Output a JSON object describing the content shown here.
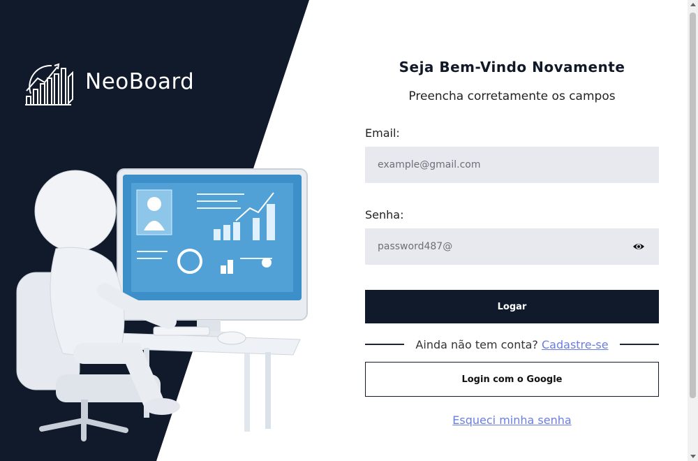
{
  "brand": {
    "name": "NeoBoard",
    "logo_icon": "chart-growth-icon"
  },
  "form": {
    "title": "Seja Bem-Vindo Novamente",
    "subtitle": "Preencha corretamente os campos",
    "email_label": "Email:",
    "email_placeholder": "example@gmail.com",
    "password_label": "Senha:",
    "password_value": "password487@",
    "password_icon": "eye-icon",
    "login_button": "Logar",
    "signup_prompt": "Ainda não tem conta?",
    "signup_link": "Cadastre-se",
    "google_button": "Login com o Google",
    "forgot_link": "Esqueci minha senha"
  },
  "colors": {
    "dark": "#111a2b",
    "input_bg": "#e8e9ee",
    "link": "#6a7ee0"
  }
}
